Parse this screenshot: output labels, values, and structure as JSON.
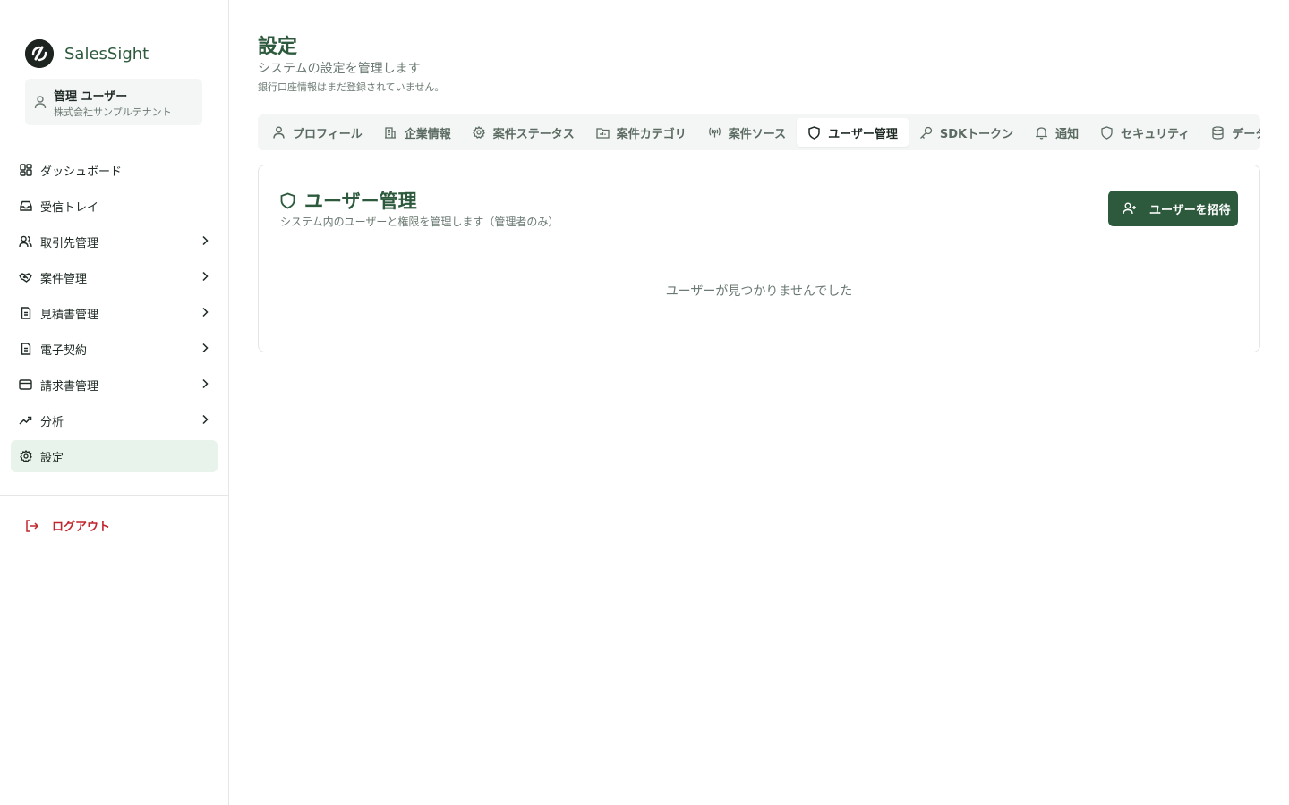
{
  "brand": {
    "name": "SalesSight",
    "logo_icon": "salessight-logo-icon"
  },
  "user": {
    "name": "管理 ユーザー",
    "tenant": "株式会社サンプルテナント",
    "icon": "user-icon"
  },
  "nav": {
    "items": [
      {
        "label": "ダッシュボード",
        "icon": "dashboard-icon",
        "has_children": false,
        "active": false
      },
      {
        "label": "受信トレイ",
        "icon": "inbox-icon",
        "has_children": false,
        "active": false
      },
      {
        "label": "取引先管理",
        "icon": "users-icon",
        "has_children": true,
        "active": false
      },
      {
        "label": "案件管理",
        "icon": "handshake-icon",
        "has_children": true,
        "active": false
      },
      {
        "label": "見積書管理",
        "icon": "document-icon",
        "has_children": true,
        "active": false
      },
      {
        "label": "電子契約",
        "icon": "document-icon",
        "has_children": true,
        "active": false
      },
      {
        "label": "請求書管理",
        "icon": "credit-card-icon",
        "has_children": true,
        "active": false
      },
      {
        "label": "分析",
        "icon": "trending-up-icon",
        "has_children": true,
        "active": false
      },
      {
        "label": "設定",
        "icon": "gear-icon",
        "has_children": false,
        "active": true
      }
    ],
    "logout_label": "ログアウト"
  },
  "page": {
    "title": "設定",
    "subtitle": "システムの設定を管理します",
    "note": "銀行口座情報はまだ登録されていません。"
  },
  "tabs": [
    {
      "label": "プロフィール",
      "icon": "user-icon",
      "active": false
    },
    {
      "label": "企業情報",
      "icon": "building-icon",
      "active": false
    },
    {
      "label": "案件ステータス",
      "icon": "gear-icon",
      "active": false
    },
    {
      "label": "案件カテゴリ",
      "icon": "folder-icon",
      "active": false
    },
    {
      "label": "案件ソース",
      "icon": "radio-icon",
      "active": false
    },
    {
      "label": "ユーザー管理",
      "icon": "shield-icon",
      "active": true
    },
    {
      "label": "SDKトークン",
      "icon": "key-icon",
      "active": false
    },
    {
      "label": "通知",
      "icon": "bell-icon",
      "active": false
    },
    {
      "label": "セキュリティ",
      "icon": "shield-icon",
      "active": false
    },
    {
      "label": "データ管理",
      "icon": "database-icon",
      "active": false
    },
    {
      "label": "",
      "icon": "file-icon",
      "active": false
    }
  ],
  "user_management": {
    "title": "ユーザー管理",
    "description": "システム内のユーザーと権限を管理します（管理者のみ）",
    "invite_label": "ユーザーを招待",
    "empty_message": "ユーザーが見つかりませんでした"
  },
  "colors": {
    "accent": "#2d5a3d",
    "active_bg": "#e8f3eb",
    "danger": "#c0262d",
    "muted_text": "#6b7a72",
    "tab_bg": "#f4f6f5"
  }
}
